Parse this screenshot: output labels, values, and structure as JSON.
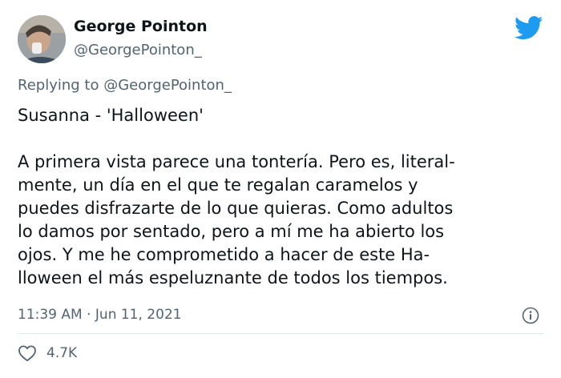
{
  "author": {
    "name": "George Pointon",
    "handle": "@GeorgePointon_"
  },
  "reply": {
    "prefix": "Replying to ",
    "mention": "@GeorgePointon_"
  },
  "tweet": {
    "title": "Susanna - 'Halloween'",
    "lines": [
      "A primera vista parece una tontería. Pero es, literal-",
      "mente, un día en el que te regalan caramelos y",
      "puedes disfrazarte de lo que quieras. Como adultos",
      "lo damos por sentado, pero a mí me ha abierto los",
      "ojos. Y me he comprometido a hacer de este Ha-",
      "lloween el más espeluznante de todos los tiempos."
    ]
  },
  "meta": {
    "timestamp": "11:39 AM · Jun 11, 2021"
  },
  "likes": {
    "count": "4.7K"
  },
  "icons": {
    "brand": "twitter-bird-icon",
    "info": "info-icon",
    "like": "heart-icon"
  },
  "colors": {
    "brand_blue": "#1d9bf0",
    "text": "#0f1419",
    "muted": "#536471",
    "divider": "#e1e8ed"
  }
}
